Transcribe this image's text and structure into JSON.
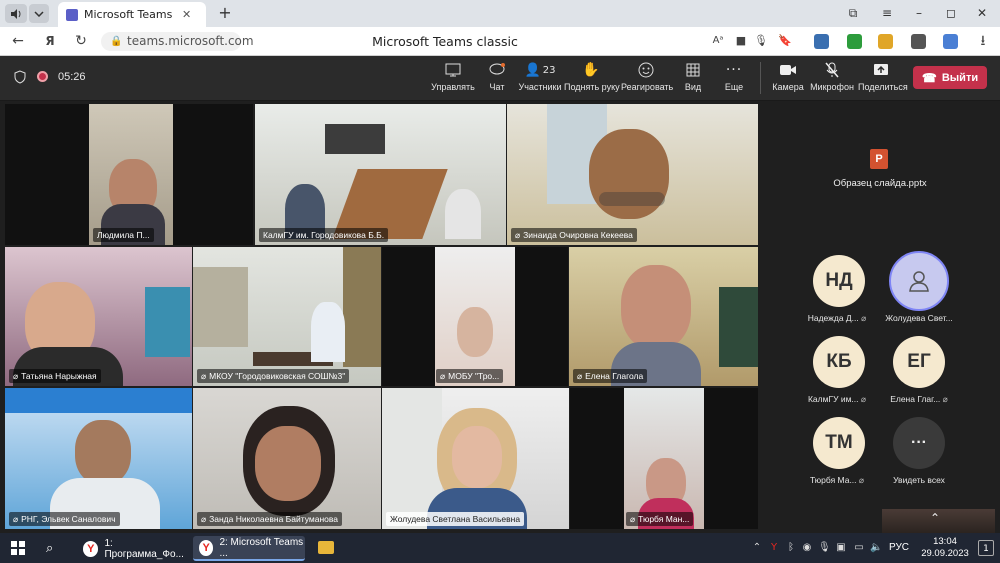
{
  "browser": {
    "tab_title": "Microsoft Teams classic",
    "url": "teams.microsoft.com",
    "page_title": "Microsoft Teams classic"
  },
  "meeting": {
    "timer": "05:26",
    "toolbar": {
      "share_tray": "Управлять",
      "chat": "Чат",
      "participants": "Участники",
      "participants_count": "23",
      "raise_hand": "Поднять руку",
      "react": "Реагировать",
      "view": "Вид",
      "more": "Еще",
      "camera": "Камера",
      "mic": "Микрофон",
      "share": "Поделиться",
      "leave": "Выйти"
    },
    "tiles": [
      {
        "name": "Людмила П..."
      },
      {
        "name": "КалмГУ им. Городовикова Б.Б."
      },
      {
        "name": "Зинаида Очировна Кекеева"
      },
      {
        "name": "Татьяна Нарыжная"
      },
      {
        "name": "МКОУ \"Городовиковская СОШ№3\""
      },
      {
        "name": "МОБУ \"Тро..."
      },
      {
        "name": "Елена Глагола"
      },
      {
        "name": "РНГ, Эльвек Саналович"
      },
      {
        "name": "Занда Николаевна Байтуманова"
      },
      {
        "name": "Жолудева Светлана Васильевна"
      },
      {
        "name": "Тюрбя Ман..."
      }
    ],
    "shared_file": "Образец слайда.pptx",
    "participants_panel": [
      {
        "initials": "НД",
        "name": "Надежда Д..."
      },
      {
        "initials": "",
        "name": "Жолудева Свет..."
      },
      {
        "initials": "КБ",
        "name": "КалмГУ им..."
      },
      {
        "initials": "ЕГ",
        "name": "Елена Глаг..."
      },
      {
        "initials": "ТМ",
        "name": "Тюрбя Ма..."
      },
      {
        "initials": "···",
        "name": "Увидеть всех"
      }
    ]
  },
  "taskbar": {
    "apps": [
      {
        "label": "1: Программа_Фо..."
      },
      {
        "label": "2: Microsoft Teams ..."
      }
    ],
    "lang": "РУС",
    "time": "13:04",
    "date": "29.09.2023",
    "notif_count": "1"
  },
  "colors": {
    "leave": "#c4314b",
    "toolbar": "#2b2b2b",
    "accent": "#6264a7"
  }
}
